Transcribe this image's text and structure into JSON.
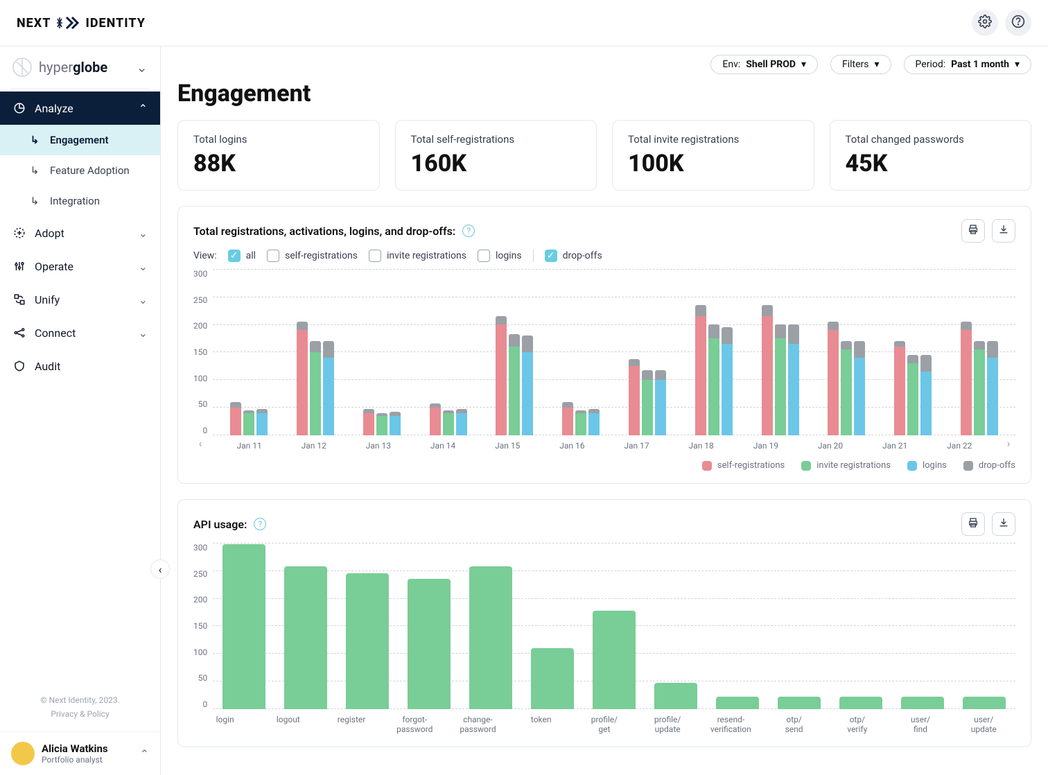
{
  "brand": {
    "left": "NEXT",
    "right": "IDENTITY"
  },
  "tenant": {
    "prefix": "hyper",
    "suffix": "globe"
  },
  "filters": {
    "env_label": "Env:",
    "env_value": "Shell PROD",
    "filters_label": "Filters",
    "period_label": "Period:",
    "period_value": "Past 1 month"
  },
  "page_title": "Engagement",
  "nav": {
    "analyze": "Analyze",
    "engagement": "Engagement",
    "feature_adoption": "Feature Adoption",
    "integration": "Integration",
    "adopt": "Adopt",
    "operate": "Operate",
    "unify": "Unify",
    "connect": "Connect",
    "audit": "Audit"
  },
  "kpis": [
    {
      "label": "Total logins",
      "value": "88K"
    },
    {
      "label": "Total self-registrations",
      "value": "160K"
    },
    {
      "label": "Total invite registrations",
      "value": "100K"
    },
    {
      "label": "Total changed passwords",
      "value": "45K"
    }
  ],
  "chart1": {
    "title": "Total registrations, activations, logins, and drop-offs:",
    "view_label": "View:",
    "filters": {
      "all": "all",
      "self": "self-registrations",
      "invite": "invite registrations",
      "logins": "logins",
      "dropoffs": "drop-offs"
    },
    "legend": {
      "self": "self-registrations",
      "invite": "invite registrations",
      "logins": "logins",
      "dropoffs": "drop-offs"
    }
  },
  "chart2": {
    "title": "API usage:"
  },
  "footer": {
    "copyright": "© Next Identity, 2023.",
    "privacy": "Privacy & Policy"
  },
  "user": {
    "name": "Alicia Watkins",
    "role": "Portfolio analyst"
  },
  "colors": {
    "self": "#e98b93",
    "invite": "#79cd97",
    "logins": "#6cc6e8",
    "dropoffs": "#9aa0a6",
    "api": "#79cd97"
  },
  "chart_data": [
    {
      "type": "bar",
      "title": "Total registrations, activations, logins, and drop-offs:",
      "categories": [
        "Jan 11",
        "Jan 12",
        "Jan 13",
        "Jan 14",
        "Jan 15",
        "Jan 16",
        "Jan 17",
        "Jan 18",
        "Jan 19",
        "Jan 20",
        "Jan 21",
        "Jan 22"
      ],
      "ylim": [
        0,
        300
      ],
      "yticks": [
        0,
        50,
        100,
        150,
        200,
        250,
        300
      ],
      "stacked_series": [
        {
          "name": "self-registrations",
          "base": [
            50,
            190,
            40,
            50,
            200,
            50,
            125,
            215,
            215,
            190,
            160,
            190
          ],
          "dropoff": [
            10,
            15,
            8,
            8,
            15,
            10,
            12,
            20,
            20,
            15,
            10,
            15
          ]
        },
        {
          "name": "invite registrations",
          "base": [
            40,
            150,
            35,
            40,
            160,
            40,
            100,
            175,
            175,
            155,
            130,
            155
          ],
          "dropoff": [
            5,
            20,
            5,
            5,
            22,
            5,
            18,
            25,
            25,
            15,
            15,
            15
          ]
        },
        {
          "name": "logins",
          "base": [
            40,
            140,
            35,
            40,
            150,
            40,
            100,
            165,
            165,
            140,
            115,
            140
          ],
          "dropoff": [
            8,
            30,
            8,
            8,
            30,
            8,
            18,
            30,
            35,
            30,
            30,
            30
          ]
        }
      ],
      "legend": [
        "self-registrations",
        "invite registrations",
        "logins",
        "drop-offs"
      ]
    },
    {
      "type": "bar",
      "title": "API usage:",
      "categories": [
        "login",
        "logout",
        "register",
        "forgot-password",
        "change-password",
        "token",
        "profile/get",
        "profile/update",
        "resend-verification",
        "otp/send",
        "otp/verify",
        "user/find",
        "user/update"
      ],
      "values": [
        298,
        258,
        245,
        235,
        258,
        110,
        178,
        48,
        22,
        22,
        22,
        22,
        22
      ],
      "ylim": [
        0,
        300
      ],
      "yticks": [
        0,
        50,
        100,
        150,
        200,
        250,
        300
      ]
    }
  ]
}
